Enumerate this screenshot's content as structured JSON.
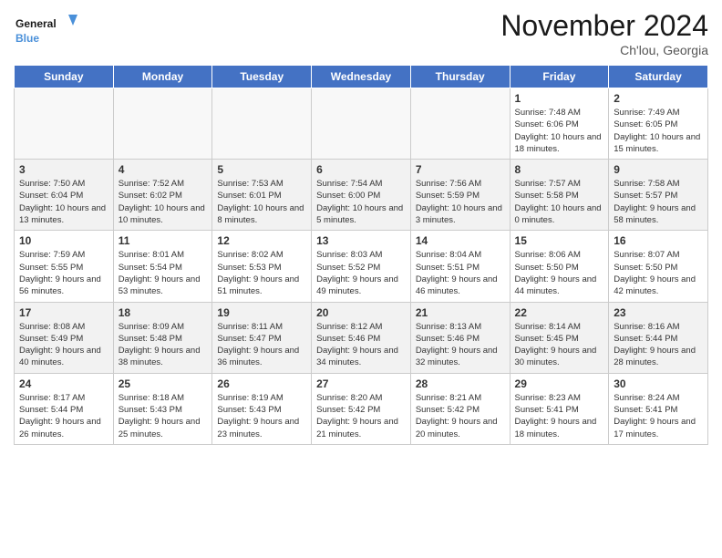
{
  "header": {
    "title": "November 2024",
    "location": "Ch'lou, Georgia",
    "logo_general": "General",
    "logo_blue": "Blue"
  },
  "weekdays": [
    "Sunday",
    "Monday",
    "Tuesday",
    "Wednesday",
    "Thursday",
    "Friday",
    "Saturday"
  ],
  "weeks": [
    [
      {
        "day": "",
        "info": "",
        "empty": true
      },
      {
        "day": "",
        "info": "",
        "empty": true
      },
      {
        "day": "",
        "info": "",
        "empty": true
      },
      {
        "day": "",
        "info": "",
        "empty": true
      },
      {
        "day": "",
        "info": "",
        "empty": true
      },
      {
        "day": "1",
        "info": "Sunrise: 7:48 AM\nSunset: 6:06 PM\nDaylight: 10 hours and 18 minutes."
      },
      {
        "day": "2",
        "info": "Sunrise: 7:49 AM\nSunset: 6:05 PM\nDaylight: 10 hours and 15 minutes."
      }
    ],
    [
      {
        "day": "3",
        "info": "Sunrise: 7:50 AM\nSunset: 6:04 PM\nDaylight: 10 hours and 13 minutes."
      },
      {
        "day": "4",
        "info": "Sunrise: 7:52 AM\nSunset: 6:02 PM\nDaylight: 10 hours and 10 minutes."
      },
      {
        "day": "5",
        "info": "Sunrise: 7:53 AM\nSunset: 6:01 PM\nDaylight: 10 hours and 8 minutes."
      },
      {
        "day": "6",
        "info": "Sunrise: 7:54 AM\nSunset: 6:00 PM\nDaylight: 10 hours and 5 minutes."
      },
      {
        "day": "7",
        "info": "Sunrise: 7:56 AM\nSunset: 5:59 PM\nDaylight: 10 hours and 3 minutes."
      },
      {
        "day": "8",
        "info": "Sunrise: 7:57 AM\nSunset: 5:58 PM\nDaylight: 10 hours and 0 minutes."
      },
      {
        "day": "9",
        "info": "Sunrise: 7:58 AM\nSunset: 5:57 PM\nDaylight: 9 hours and 58 minutes."
      }
    ],
    [
      {
        "day": "10",
        "info": "Sunrise: 7:59 AM\nSunset: 5:55 PM\nDaylight: 9 hours and 56 minutes."
      },
      {
        "day": "11",
        "info": "Sunrise: 8:01 AM\nSunset: 5:54 PM\nDaylight: 9 hours and 53 minutes."
      },
      {
        "day": "12",
        "info": "Sunrise: 8:02 AM\nSunset: 5:53 PM\nDaylight: 9 hours and 51 minutes."
      },
      {
        "day": "13",
        "info": "Sunrise: 8:03 AM\nSunset: 5:52 PM\nDaylight: 9 hours and 49 minutes."
      },
      {
        "day": "14",
        "info": "Sunrise: 8:04 AM\nSunset: 5:51 PM\nDaylight: 9 hours and 46 minutes."
      },
      {
        "day": "15",
        "info": "Sunrise: 8:06 AM\nSunset: 5:50 PM\nDaylight: 9 hours and 44 minutes."
      },
      {
        "day": "16",
        "info": "Sunrise: 8:07 AM\nSunset: 5:50 PM\nDaylight: 9 hours and 42 minutes."
      }
    ],
    [
      {
        "day": "17",
        "info": "Sunrise: 8:08 AM\nSunset: 5:49 PM\nDaylight: 9 hours and 40 minutes."
      },
      {
        "day": "18",
        "info": "Sunrise: 8:09 AM\nSunset: 5:48 PM\nDaylight: 9 hours and 38 minutes."
      },
      {
        "day": "19",
        "info": "Sunrise: 8:11 AM\nSunset: 5:47 PM\nDaylight: 9 hours and 36 minutes."
      },
      {
        "day": "20",
        "info": "Sunrise: 8:12 AM\nSunset: 5:46 PM\nDaylight: 9 hours and 34 minutes."
      },
      {
        "day": "21",
        "info": "Sunrise: 8:13 AM\nSunset: 5:46 PM\nDaylight: 9 hours and 32 minutes."
      },
      {
        "day": "22",
        "info": "Sunrise: 8:14 AM\nSunset: 5:45 PM\nDaylight: 9 hours and 30 minutes."
      },
      {
        "day": "23",
        "info": "Sunrise: 8:16 AM\nSunset: 5:44 PM\nDaylight: 9 hours and 28 minutes."
      }
    ],
    [
      {
        "day": "24",
        "info": "Sunrise: 8:17 AM\nSunset: 5:44 PM\nDaylight: 9 hours and 26 minutes."
      },
      {
        "day": "25",
        "info": "Sunrise: 8:18 AM\nSunset: 5:43 PM\nDaylight: 9 hours and 25 minutes."
      },
      {
        "day": "26",
        "info": "Sunrise: 8:19 AM\nSunset: 5:43 PM\nDaylight: 9 hours and 23 minutes."
      },
      {
        "day": "27",
        "info": "Sunrise: 8:20 AM\nSunset: 5:42 PM\nDaylight: 9 hours and 21 minutes."
      },
      {
        "day": "28",
        "info": "Sunrise: 8:21 AM\nSunset: 5:42 PM\nDaylight: 9 hours and 20 minutes."
      },
      {
        "day": "29",
        "info": "Sunrise: 8:23 AM\nSunset: 5:41 PM\nDaylight: 9 hours and 18 minutes."
      },
      {
        "day": "30",
        "info": "Sunrise: 8:24 AM\nSunset: 5:41 PM\nDaylight: 9 hours and 17 minutes."
      }
    ]
  ]
}
